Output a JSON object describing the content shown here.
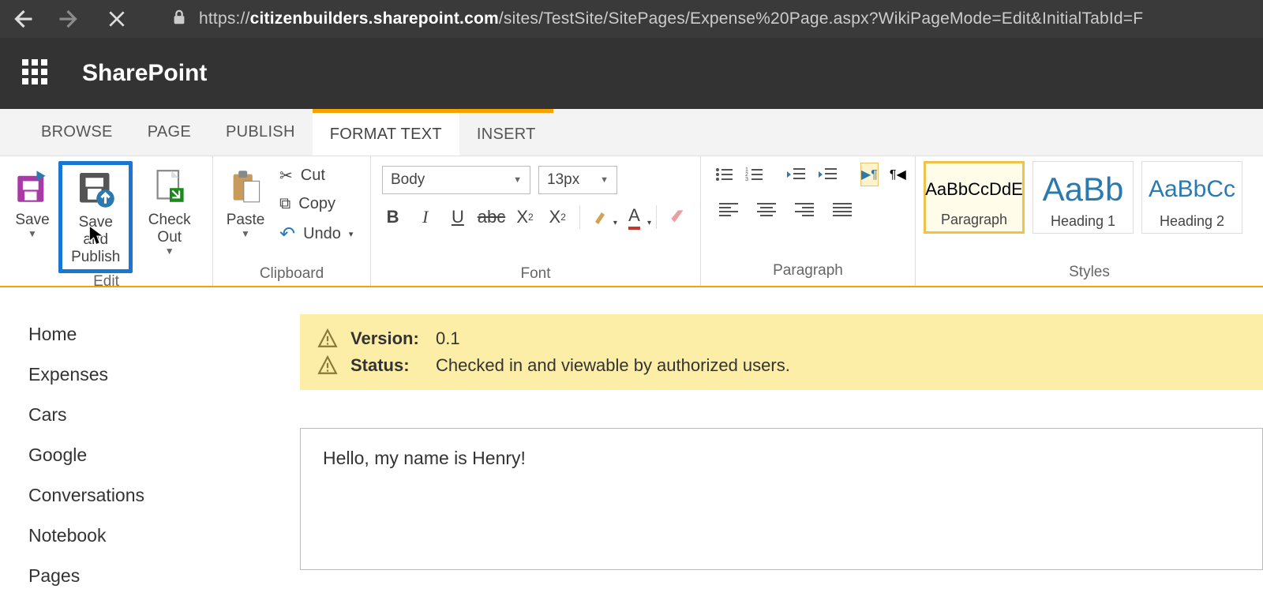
{
  "url": {
    "prefix": "https://",
    "host": "citizenbuilders.sharepoint.com",
    "path": "/sites/TestSite/SitePages/Expense%20Page.aspx?WikiPageMode=Edit&InitialTabId=F"
  },
  "brand": "SharePoint",
  "tabs": [
    "BROWSE",
    "PAGE",
    "PUBLISH",
    "FORMAT TEXT",
    "INSERT"
  ],
  "ribbon": {
    "edit": {
      "label": "Edit",
      "save": "Save",
      "save_publish_l1": "Save and",
      "save_publish_l2": "Publish",
      "checkout": "Check Out"
    },
    "clipboard": {
      "label": "Clipboard",
      "paste": "Paste",
      "cut": "Cut",
      "copy": "Copy",
      "undo": "Undo"
    },
    "font": {
      "label": "Font",
      "family": "Body",
      "size": "13px"
    },
    "paragraph": {
      "label": "Paragraph"
    },
    "styles": {
      "label": "Styles",
      "items": [
        {
          "preview": "AaBbCcDdE",
          "name": "Paragraph",
          "size": "20px",
          "color": "#444"
        },
        {
          "preview": "AaBb",
          "name": "Heading 1",
          "size": "42px",
          "color": "#2a7ab0"
        },
        {
          "preview": "AaBbCc",
          "name": "Heading 2",
          "size": "30px",
          "color": "#2a7ab0"
        }
      ]
    }
  },
  "leftnav": [
    "Home",
    "Expenses",
    "Cars",
    "Google",
    "Conversations",
    "Notebook",
    "Pages"
  ],
  "banner": {
    "version_label": "Version:",
    "version_value": "0.1",
    "status_label": "Status:",
    "status_value": "Checked in and viewable by authorized users."
  },
  "editor_text": "Hello, my name is Henry!"
}
